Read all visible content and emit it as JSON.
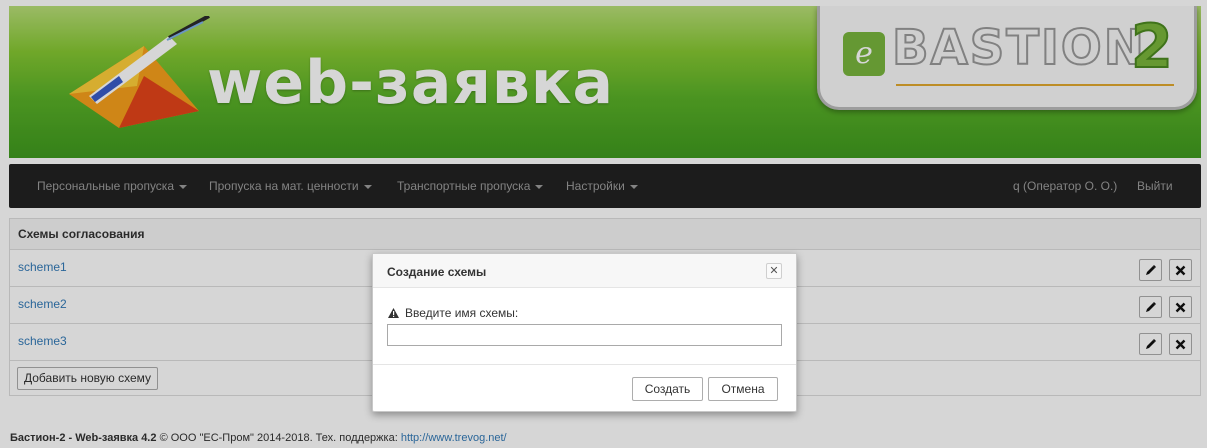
{
  "banner": {
    "title": "web-заявка",
    "bastion_e": "e",
    "bastion_word": "BASTION",
    "bastion_num": "2"
  },
  "navbar": {
    "items": [
      {
        "label": "Персональные пропуска",
        "has_caret": true
      },
      {
        "label": "Пропуска на мат. ценности",
        "has_caret": true
      },
      {
        "label": "Транспортные пропуска",
        "has_caret": true
      },
      {
        "label": "Настройки",
        "has_caret": true
      }
    ],
    "user": "q (Оператор О. О.)",
    "logout": "Выйти"
  },
  "panel": {
    "title": "Схемы согласования",
    "schemes": [
      {
        "name": "scheme1",
        "edit_icon": "pencil-icon",
        "delete_icon": "close-icon"
      },
      {
        "name": "scheme2",
        "edit_icon": "pencil-icon",
        "delete_icon": "close-icon"
      },
      {
        "name": "scheme3",
        "edit_icon": "pencil-icon",
        "delete_icon": "close-icon"
      }
    ],
    "add_button": "Добавить новую схему"
  },
  "modal": {
    "title": "Создание схемы",
    "close_icon": "close-icon",
    "warning_icon": "warning-icon",
    "message": "Введите имя схемы:",
    "input_value": "",
    "create_button": "Создать",
    "cancel_button": "Отмена"
  },
  "footer": {
    "product": "Бастион-2 - Web-заявка 4.2",
    "copyright": "© ООО \"ЕС-Пром\" 2014-2018. Тех. поддержка:",
    "link": "http://www.trevog.net/"
  },
  "colors": {
    "link": "#337ab7",
    "navbar_bg": "#222222",
    "navbar_text": "#9d9d9d",
    "banner_green": "#5ab128",
    "bastion_green": "#7ab63b"
  }
}
